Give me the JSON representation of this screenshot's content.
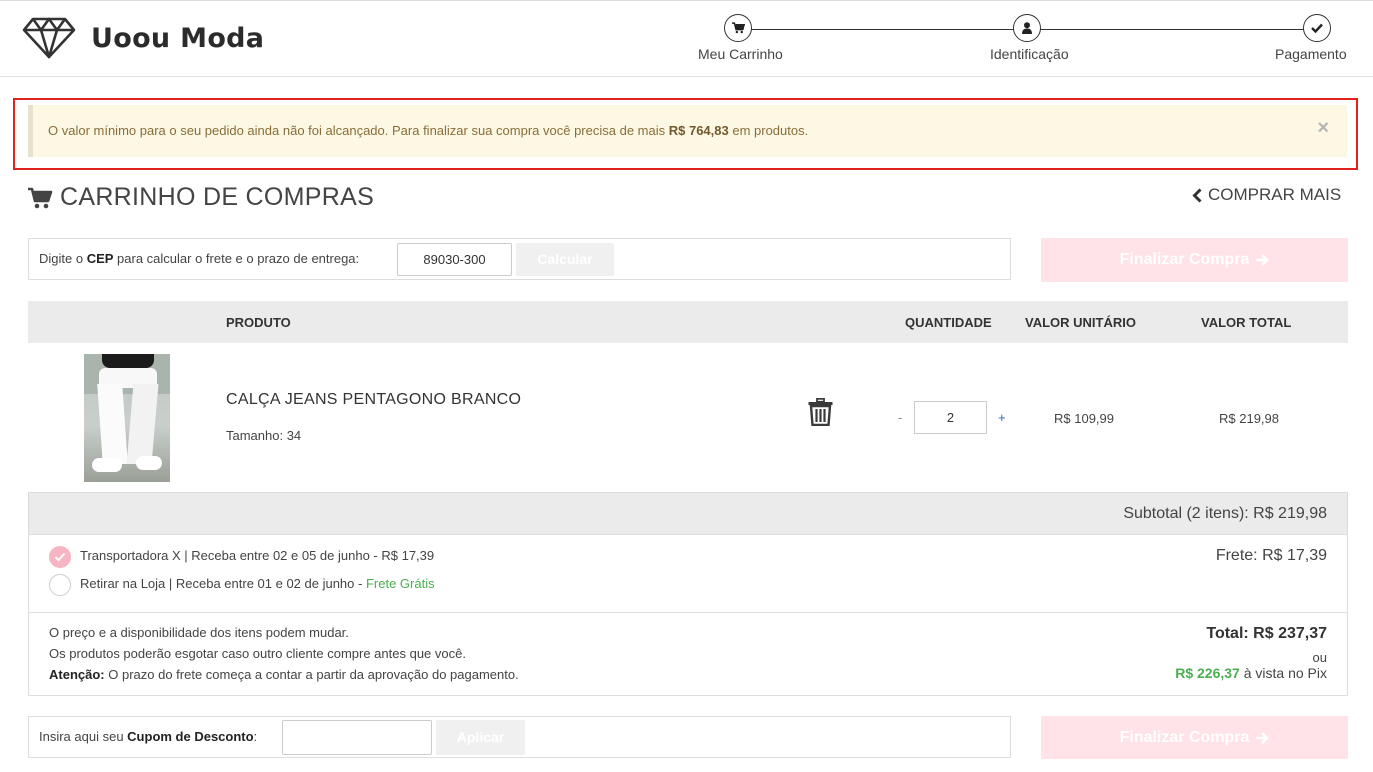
{
  "brand": {
    "name": "Uoou Moda"
  },
  "steps": [
    {
      "label": "Meu Carrinho",
      "icon": "cart-icon"
    },
    {
      "label": "Identificação",
      "icon": "user-icon"
    },
    {
      "label": "Pagamento",
      "icon": "check-icon"
    }
  ],
  "alert": {
    "text_before": "O valor mínimo para o seu pedido ainda não foi alcançado. Para finalizar sua compra você precisa de mais ",
    "amount": "R$ 764,83",
    "text_after": " em produtos.",
    "close": "×"
  },
  "cart": {
    "title": "CARRINHO DE COMPRAS",
    "comprar_mais": "COMPRAR MAIS"
  },
  "cep": {
    "label_before": "Digite o ",
    "label_bold": "CEP",
    "label_after": " para calcular o frete e o prazo de entrega:",
    "value": "89030-300",
    "button": "Calcular"
  },
  "finalizar_label": "Finalizar Compra",
  "table": {
    "headers": {
      "produto": "PRODUTO",
      "quantidade": "QUANTIDADE",
      "valor_unitario": "VALOR UNITÁRIO",
      "valor_total": "VALOR TOTAL"
    },
    "rows": [
      {
        "name": "CALÇA JEANS PENTAGONO BRANCO",
        "size": "Tamanho: 34",
        "minus": "-",
        "qty": "2",
        "plus": "+",
        "unit_price": "R$ 109,99",
        "total": "R$ 219,98"
      }
    ]
  },
  "summary": {
    "subtotal": "Subtotal (2 itens): R$ 219,98",
    "shipping_options": [
      {
        "text": "Transportadora X | Receba entre 02 e 05 de junho - R$ 17,39",
        "extra": "",
        "selected": true
      },
      {
        "text": "Retirar na Loja | Receba entre 01 e 02 de junho - ",
        "extra": "Frete Grátis",
        "selected": false
      }
    ],
    "frete": "Frete: R$ 17,39",
    "notes": {
      "line1": "O preço e a disponibilidade dos itens podem mudar.",
      "line2": "Os produtos poderão esgotar caso outro cliente compre antes que você.",
      "line3_bold": "Atenção:",
      "line3": " O prazo do frete começa a contar a partir da aprovação do pagamento."
    },
    "total": "Total: R$ 237,37",
    "ou": "ou",
    "pix_amount": "R$ 226,37",
    "pix_text": " à vista no Pix"
  },
  "cupom": {
    "label_before": "Insira aqui seu ",
    "label_bold": "Cupom de Desconto",
    "label_after": ":",
    "value": "",
    "button": "Aplicar"
  },
  "colors": {
    "alert_bg": "#fcf8e3",
    "alert_outline": "#e0211e",
    "finalizar_disabled": "#ffe3e8",
    "radio_selected": "#f7b4c2",
    "pix_green": "#4caf50"
  }
}
